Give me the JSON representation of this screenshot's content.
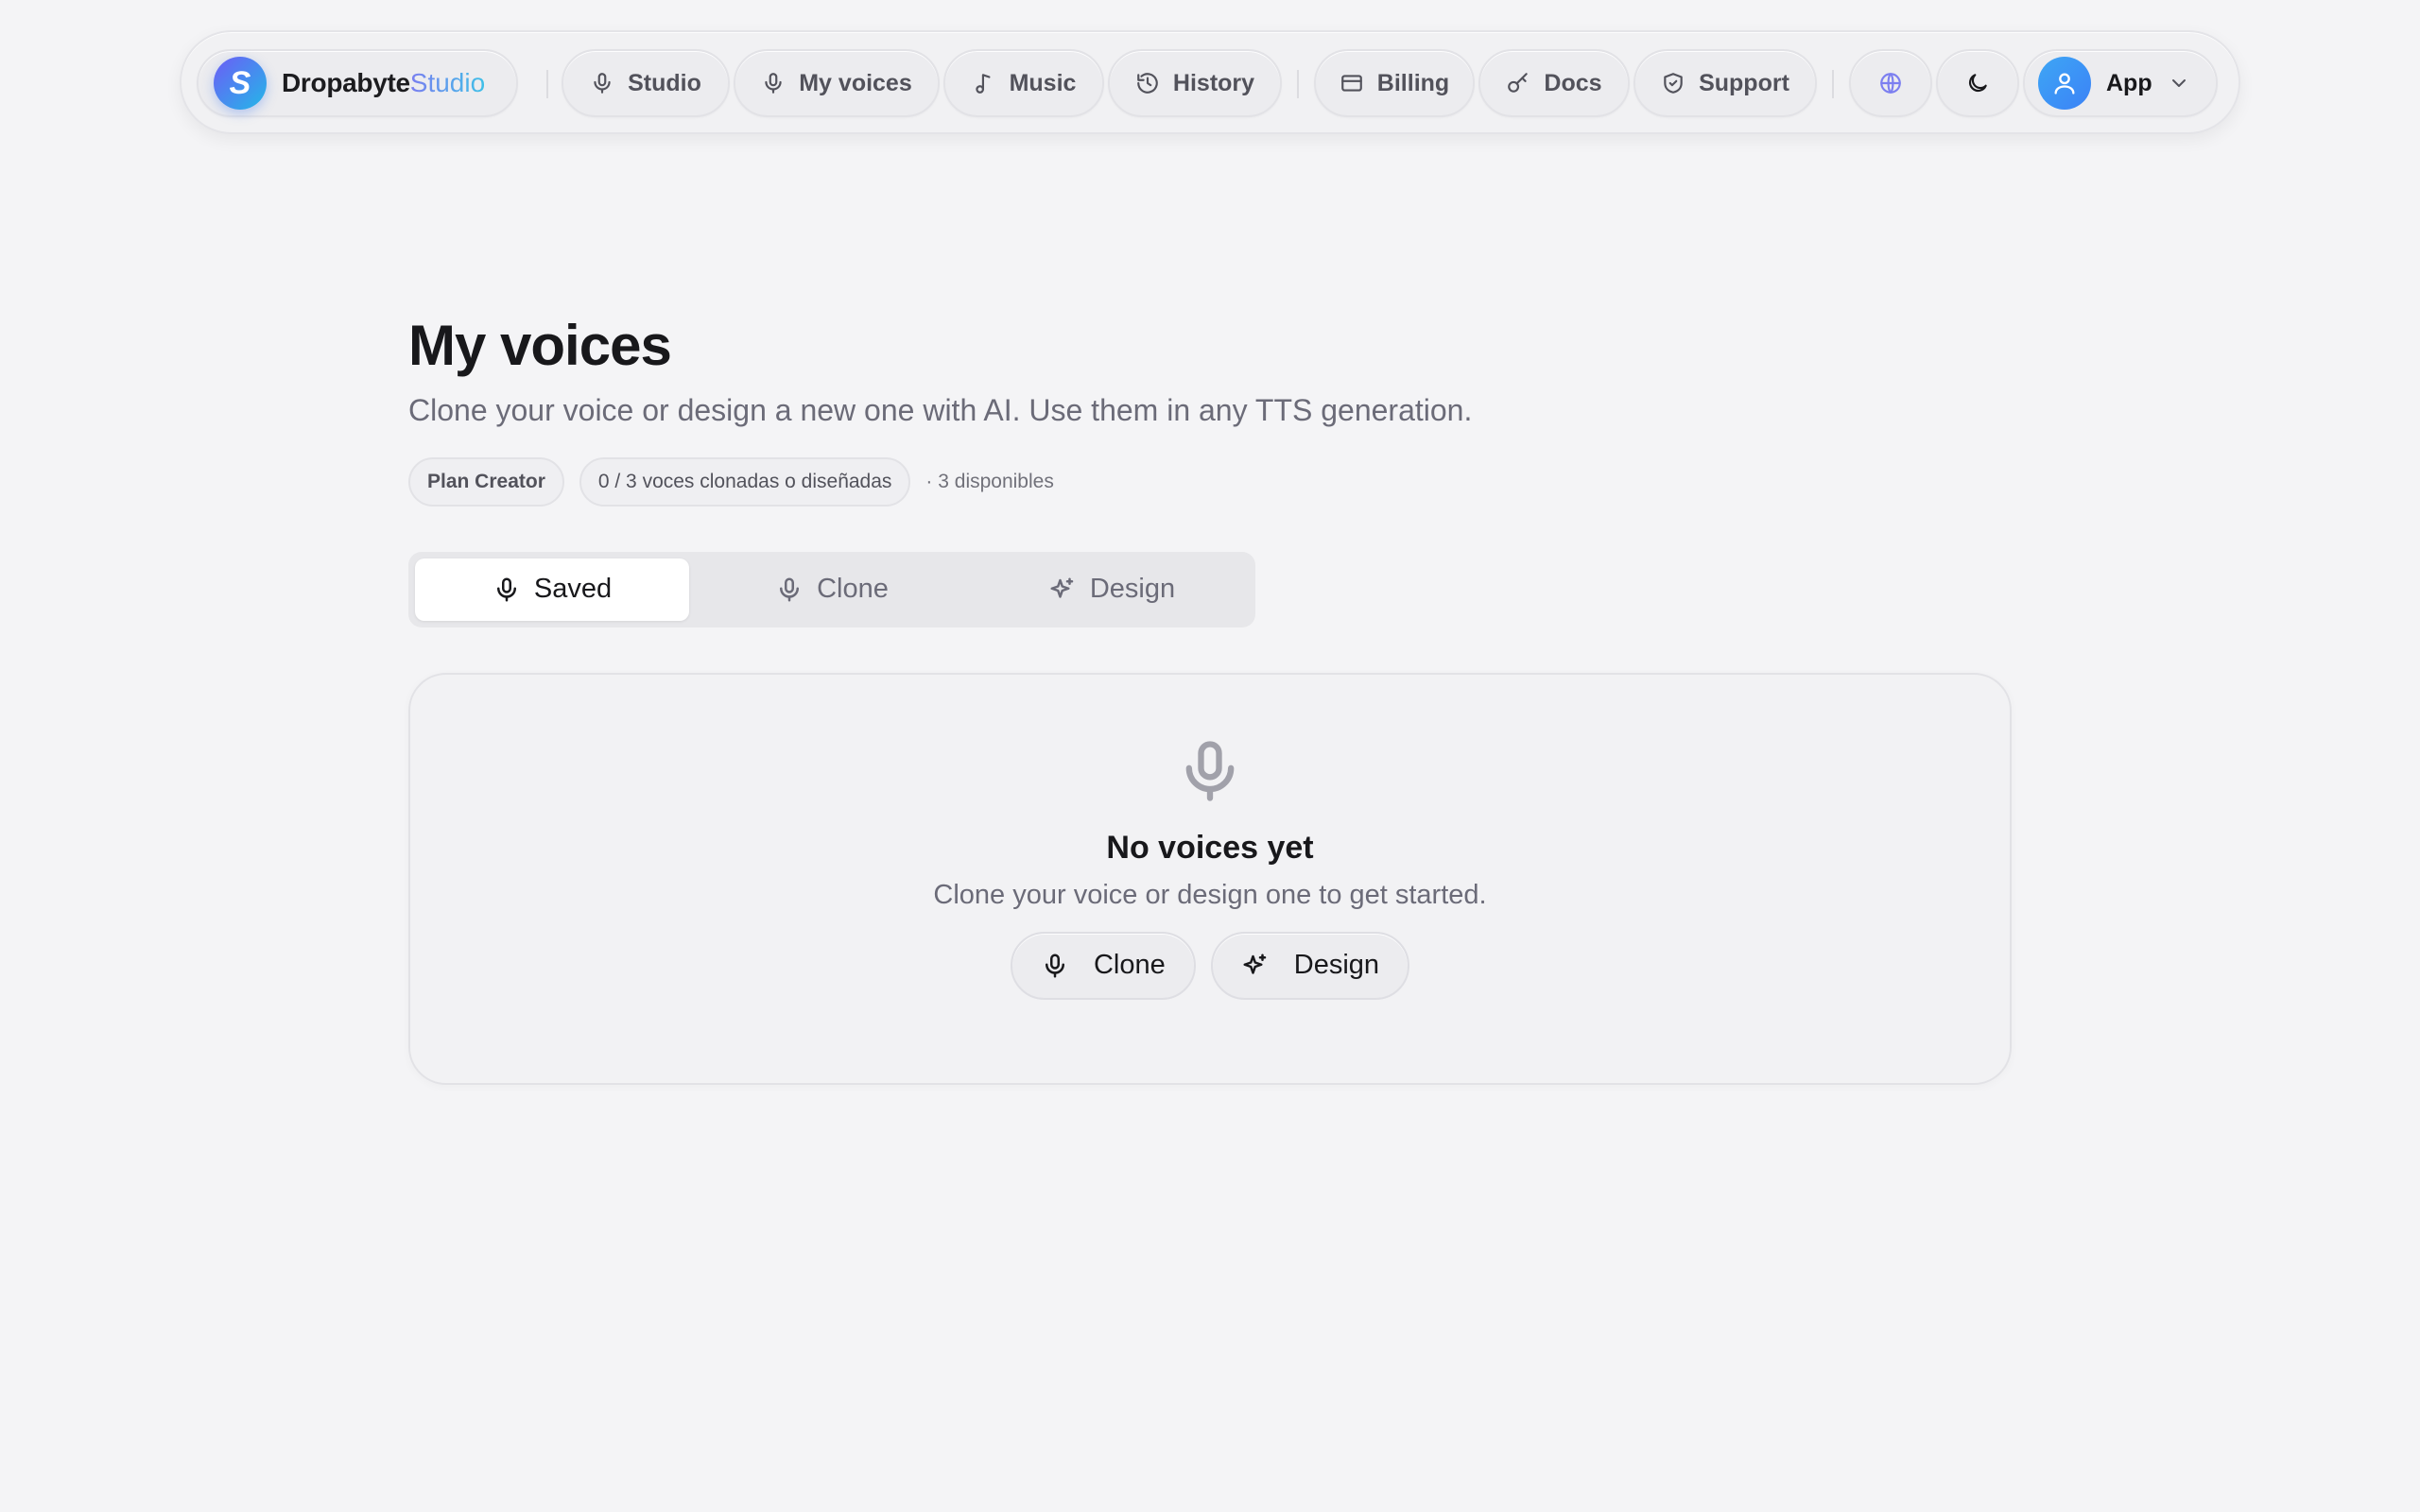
{
  "nav": {
    "brand": {
      "name": "Dropabyte",
      "accent": "Studio",
      "logo_letter": "S"
    },
    "items": [
      {
        "label": "Studio",
        "icon": "mic-icon"
      },
      {
        "label": "My voices",
        "icon": "mic-icon"
      },
      {
        "label": "Music",
        "icon": "music-note-icon"
      },
      {
        "label": "History",
        "icon": "history-icon"
      },
      {
        "label": "Billing",
        "icon": "credit-card-icon"
      },
      {
        "label": "Docs",
        "icon": "key-icon"
      },
      {
        "label": "Support",
        "icon": "shield-icon"
      }
    ],
    "language_icon": "globe-icon",
    "theme_icon": "moon-icon",
    "account": {
      "label": "App",
      "icon": "user-icon"
    }
  },
  "page": {
    "title": "My voices",
    "subtitle": "Clone your voice or design a new one with AI. Use them in any TTS generation.",
    "plan_badge": "Plan Creator",
    "usage_badge": "0 / 3 voces clonadas o diseñadas",
    "available": "· 3 disponibles"
  },
  "tabs": [
    {
      "label": "Saved",
      "icon": "mic-icon",
      "active": true
    },
    {
      "label": "Clone",
      "icon": "mic-icon",
      "active": false
    },
    {
      "label": "Design",
      "icon": "sparkles-icon",
      "active": false
    }
  ],
  "empty_state": {
    "icon": "mic-icon",
    "title": "No voices yet",
    "subtitle": "Clone your voice or design one to get started.",
    "clone_button": "Clone",
    "design_button": "Design"
  },
  "colors": {
    "background": "#f4f4f6",
    "accent_start": "#6d5cf6",
    "accent_end": "#22b8e8",
    "text_primary": "#18181b",
    "text_muted": "#6b6b78"
  }
}
